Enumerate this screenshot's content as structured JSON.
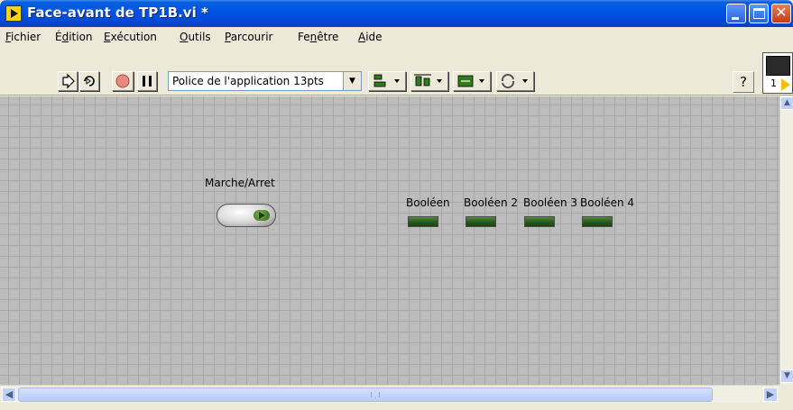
{
  "window": {
    "title": "Face-avant de TP1B.vi *",
    "colors": {
      "titlebar": "#0055e5",
      "canvas": "#bcbcbc",
      "led": "#2b5b1e"
    }
  },
  "menu": {
    "items": [
      {
        "label": "Fichier",
        "accel": "F"
      },
      {
        "label": "Édition",
        "accel": "d"
      },
      {
        "label": "Exécution",
        "accel": "E"
      },
      {
        "label": "Outils",
        "accel": "O"
      },
      {
        "label": "Parcourir",
        "accel": "P"
      },
      {
        "label": "Fenêtre",
        "accel": "n"
      },
      {
        "label": "Aide",
        "accel": "A"
      }
    ]
  },
  "toolbar": {
    "font_select_value": "Police de l'application 13pts",
    "connector_pane_number": "1",
    "icons": [
      "run-arrow-icon",
      "run-continuously-icon",
      "abort-icon",
      "pause-icon",
      "align-objects-icon",
      "distribute-objects-icon",
      "resize-objects-icon",
      "reorder-icon",
      "help-icon"
    ]
  },
  "panel": {
    "switch": {
      "label": "Marche/Arret"
    },
    "leds": [
      {
        "label": "Booléen"
      },
      {
        "label": "Booléen 2"
      },
      {
        "label": "Booléen 3"
      },
      {
        "label": "Booléen 4"
      }
    ]
  }
}
